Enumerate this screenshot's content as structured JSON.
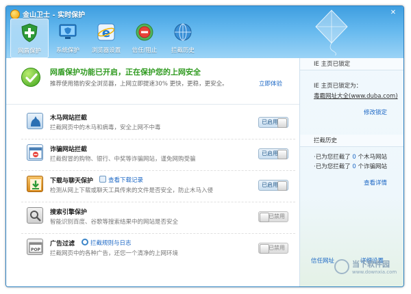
{
  "window": {
    "title": "金山卫士 - 实时保护",
    "controls": {
      "close": "✕"
    }
  },
  "nav": [
    {
      "label": "网盾保护",
      "icon": "shield-plus-icon",
      "active": true
    },
    {
      "label": "系统保护",
      "icon": "monitor-shield-icon",
      "active": false
    },
    {
      "label": "浏览器设置",
      "icon": "ie-browser-icon",
      "active": false
    },
    {
      "label": "信任/阻止",
      "icon": "block-icon",
      "active": false
    },
    {
      "label": "拦截历史",
      "icon": "globe-history-icon",
      "active": false
    }
  ],
  "hero": {
    "title": "网盾保护功能已开启，正在保护您的上网安全",
    "subtitle": "推荐使用猎豹安全浏览器，上网立即提速30% 更快，更稳，更安全。",
    "link": "立即体验"
  },
  "features": [
    {
      "title": "木马网站拦截",
      "desc": "拦截网页中的木马和病毒，安全上网不中毒",
      "status": "已启用",
      "enabled": true,
      "icon": "trojan-site-icon"
    },
    {
      "title": "诈骗网站拦截",
      "desc": "拦截假冒的购物、银行、中奖等诈骗网站，谨免网购受骗",
      "status": "已启用",
      "enabled": true,
      "icon": "fraud-site-icon"
    },
    {
      "title": "下载与聊天保护",
      "link": "查看下载记录",
      "desc": "检测从网上下载或聊天工具传来的文件是否安全，防止木马入侵",
      "status": "已启用",
      "enabled": true,
      "icon": "download-protect-icon"
    },
    {
      "title": "搜索引擎保护",
      "desc": "智能识别百度、谷歌等搜索结果中的网站是否安全",
      "status": "已禁用",
      "enabled": false,
      "icon": "search-protect-icon"
    },
    {
      "title": "广告过滤",
      "link": "拦截规则与日志",
      "desc": "拦截网页中的各种广告，还您一个清净的上网环境",
      "status": "已禁用",
      "enabled": false,
      "icon": "popup-ad-icon"
    }
  ],
  "side": {
    "homepage": {
      "header": "IE 主页已锁定",
      "locked_label": "IE 主页已锁定为：",
      "locked_value": "毒霸网址大全(www.duba.com)",
      "link": "修改锁定"
    },
    "history": {
      "header": "拦截历史",
      "line1_pre": "·已为您拦截了 ",
      "line1_num": "0",
      "line1_post": " 个木马网站",
      "line2_pre": "·已为您拦截了 ",
      "line2_num": "0",
      "line2_post": " 个诈骗网站",
      "link": "查看详情"
    },
    "footer": {
      "trust": "信任网址",
      "settings": "详细设置"
    }
  },
  "watermark": {
    "title": "当下软件园",
    "url": "www.downxia.com"
  }
}
